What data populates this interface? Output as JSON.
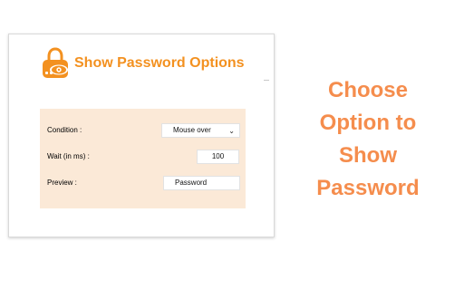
{
  "options_page": {
    "title": "Show Password Options",
    "fields": [
      {
        "label": "Condition :",
        "value": "Mouse over"
      },
      {
        "label": "Wait (in ms) :",
        "value": "100"
      },
      {
        "label": "Preview :",
        "value": "Password"
      }
    ]
  },
  "promo": {
    "lines": [
      "Choose",
      "Option to",
      "Show",
      "Password"
    ]
  },
  "colors": {
    "accent": "#f39120",
    "promo_text": "#f58d4d",
    "panel_background": "#fbe9d7"
  },
  "icons": {
    "logo": "lock-eye-icon",
    "select_arrow": "chevron-down-icon"
  }
}
